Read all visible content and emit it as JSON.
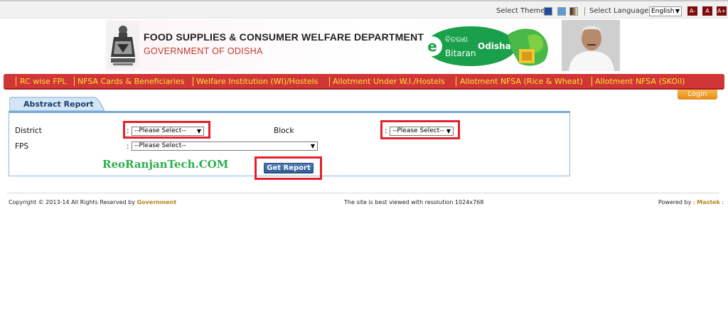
{
  "topbar": {
    "theme_label": "Select Theme",
    "theme_colors": [
      "#2a5fb0",
      "#5a9ad8",
      "#6b4a2a"
    ],
    "language_label": "Select Language",
    "language_value": "English",
    "font_buttons": [
      "A-",
      "A",
      "A+"
    ]
  },
  "header": {
    "department_title": "FOOD  SUPPLIES & CONSUMER WELFARE DEPARTMENT",
    "government": "GOVERNMENT OF ODISHA",
    "logo": {
      "letter": "e",
      "odia_text": "ବିତରଣ",
      "bitaran": "Bitaran",
      "odisha": "Odisha"
    }
  },
  "nav": {
    "items": [
      "RC wise FPL",
      "NFSA Cards & Beneficiaries",
      "Welfare Institution (WI)/Hostels",
      "Allotment Under W.I./Hostels",
      "Allotment NFSA (Rice & Wheat)",
      "Allotment NFSA (SKOil)"
    ],
    "login_label": "Login"
  },
  "report": {
    "tab_title": "Abstract Report",
    "district_label": "District",
    "district_value": "--Please Select--",
    "block_label": "Block",
    "block_value": "--Please Select--",
    "fps_label": "FPS",
    "fps_value": "--Please Select--",
    "colon": ":",
    "watermark": "ReoRanjanTech.COM",
    "button_label": "Get Report"
  },
  "footer": {
    "copyright": "Copyright © 2013-14 All Rights Reserved by",
    "copyright_link": "Government",
    "resolution_note": "The site is best viewed with resolution 1024x768",
    "powered_by": "Powered by :",
    "powered_link": "Mastek",
    "powered_suffix": ":"
  }
}
